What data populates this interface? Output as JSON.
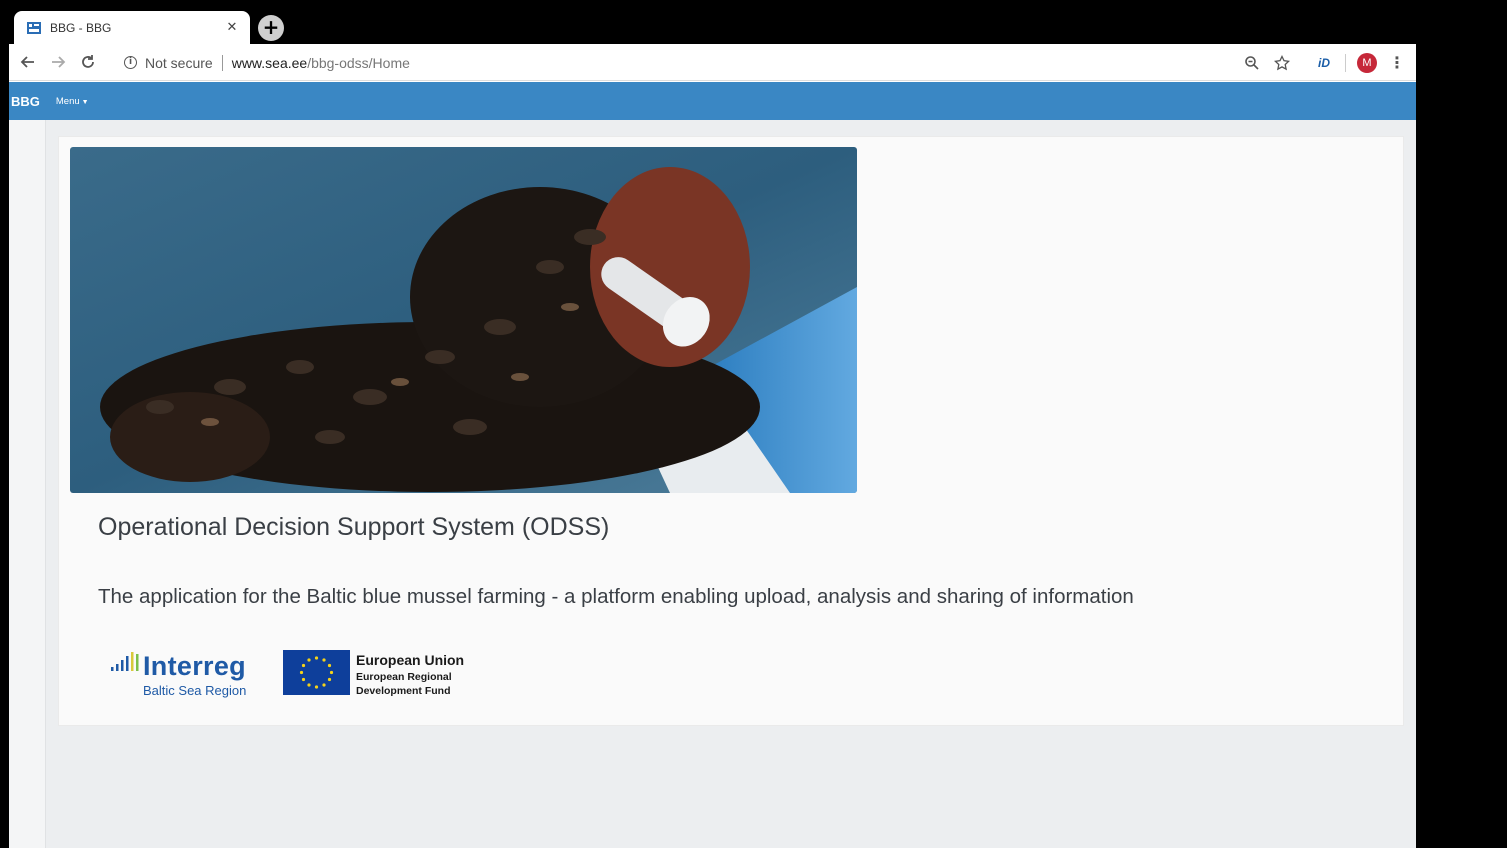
{
  "browser": {
    "tab": {
      "title": "BBG - BBG",
      "favicon": "bbg-flag-icon"
    },
    "address": {
      "security_label": "Not secure",
      "url_host": "www.sea.ee",
      "url_path": "/bbg-odss/Home"
    },
    "profile_initial": "M",
    "extension_label": "iD"
  },
  "navbar": {
    "brand": "BBG",
    "menu_label": "Menu"
  },
  "main": {
    "title": "Operational Decision Support System (ODSS)",
    "subtitle": "The application for the Baltic blue mussel farming - a platform enabling upload, analysis and sharing of information"
  },
  "logos": {
    "interreg": {
      "name": "Interreg",
      "region": "Baltic Sea Region"
    },
    "eu": {
      "name": "European Union",
      "fund_line1": "European Regional",
      "fund_line2": "Development Fund"
    }
  },
  "colors": {
    "navbar": "#3a87c4",
    "interreg_blue": "#1f5aa6",
    "eu_blue": "#0e3f9b",
    "avatar": "#c62839"
  }
}
